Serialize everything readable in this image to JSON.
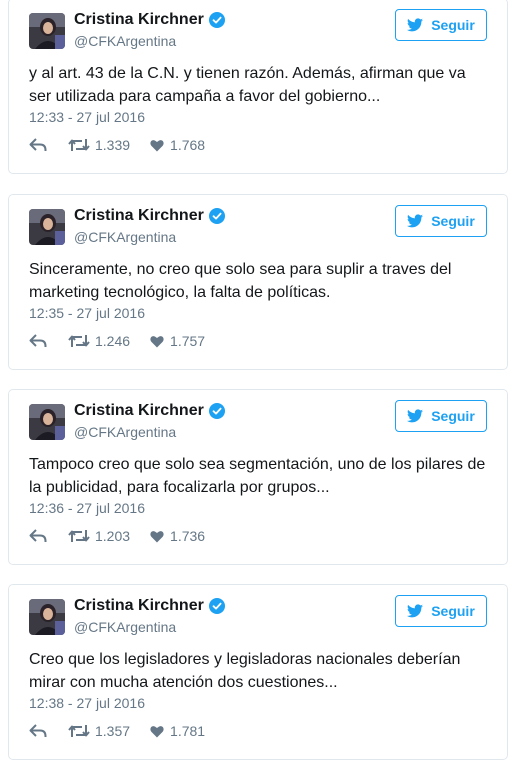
{
  "colors": {
    "accent": "#1da1f2",
    "muted": "#657786",
    "border": "#e1e8ed"
  },
  "tweets": [
    {
      "author": "Cristina Kirchner",
      "handle": "@CFKArgentina",
      "follow_label": "Seguir",
      "text": "y al art. 43 de la C.N. y tienen razón. Además, afirman que va ser utilizada para campaña a favor del gobierno...",
      "time": "12:33 - 27 jul 2016",
      "retweets": "1.339",
      "likes": "1.768"
    },
    {
      "author": "Cristina Kirchner",
      "handle": "@CFKArgentina",
      "follow_label": "Seguir",
      "text": "Sinceramente, no creo que solo sea para suplir a traves del marketing tecnológico, la falta de políticas.",
      "time": "12:35 - 27 jul 2016",
      "retweets": "1.246",
      "likes": "1.757"
    },
    {
      "author": "Cristina Kirchner",
      "handle": "@CFKArgentina",
      "follow_label": "Seguir",
      "text": "Tampoco creo que solo sea segmentación, uno de los pilares de la publicidad, para focalizarla por grupos...",
      "time": "12:36 - 27 jul 2016",
      "retweets": "1.203",
      "likes": "1.736"
    },
    {
      "author": "Cristina Kirchner",
      "handle": "@CFKArgentina",
      "follow_label": "Seguir",
      "text": "Creo que los legisladores y legisladoras nacionales deberían mirar con mucha atención dos cuestiones...",
      "time": "12:38 - 27 jul 2016",
      "retweets": "1.357",
      "likes": "1.781"
    }
  ]
}
